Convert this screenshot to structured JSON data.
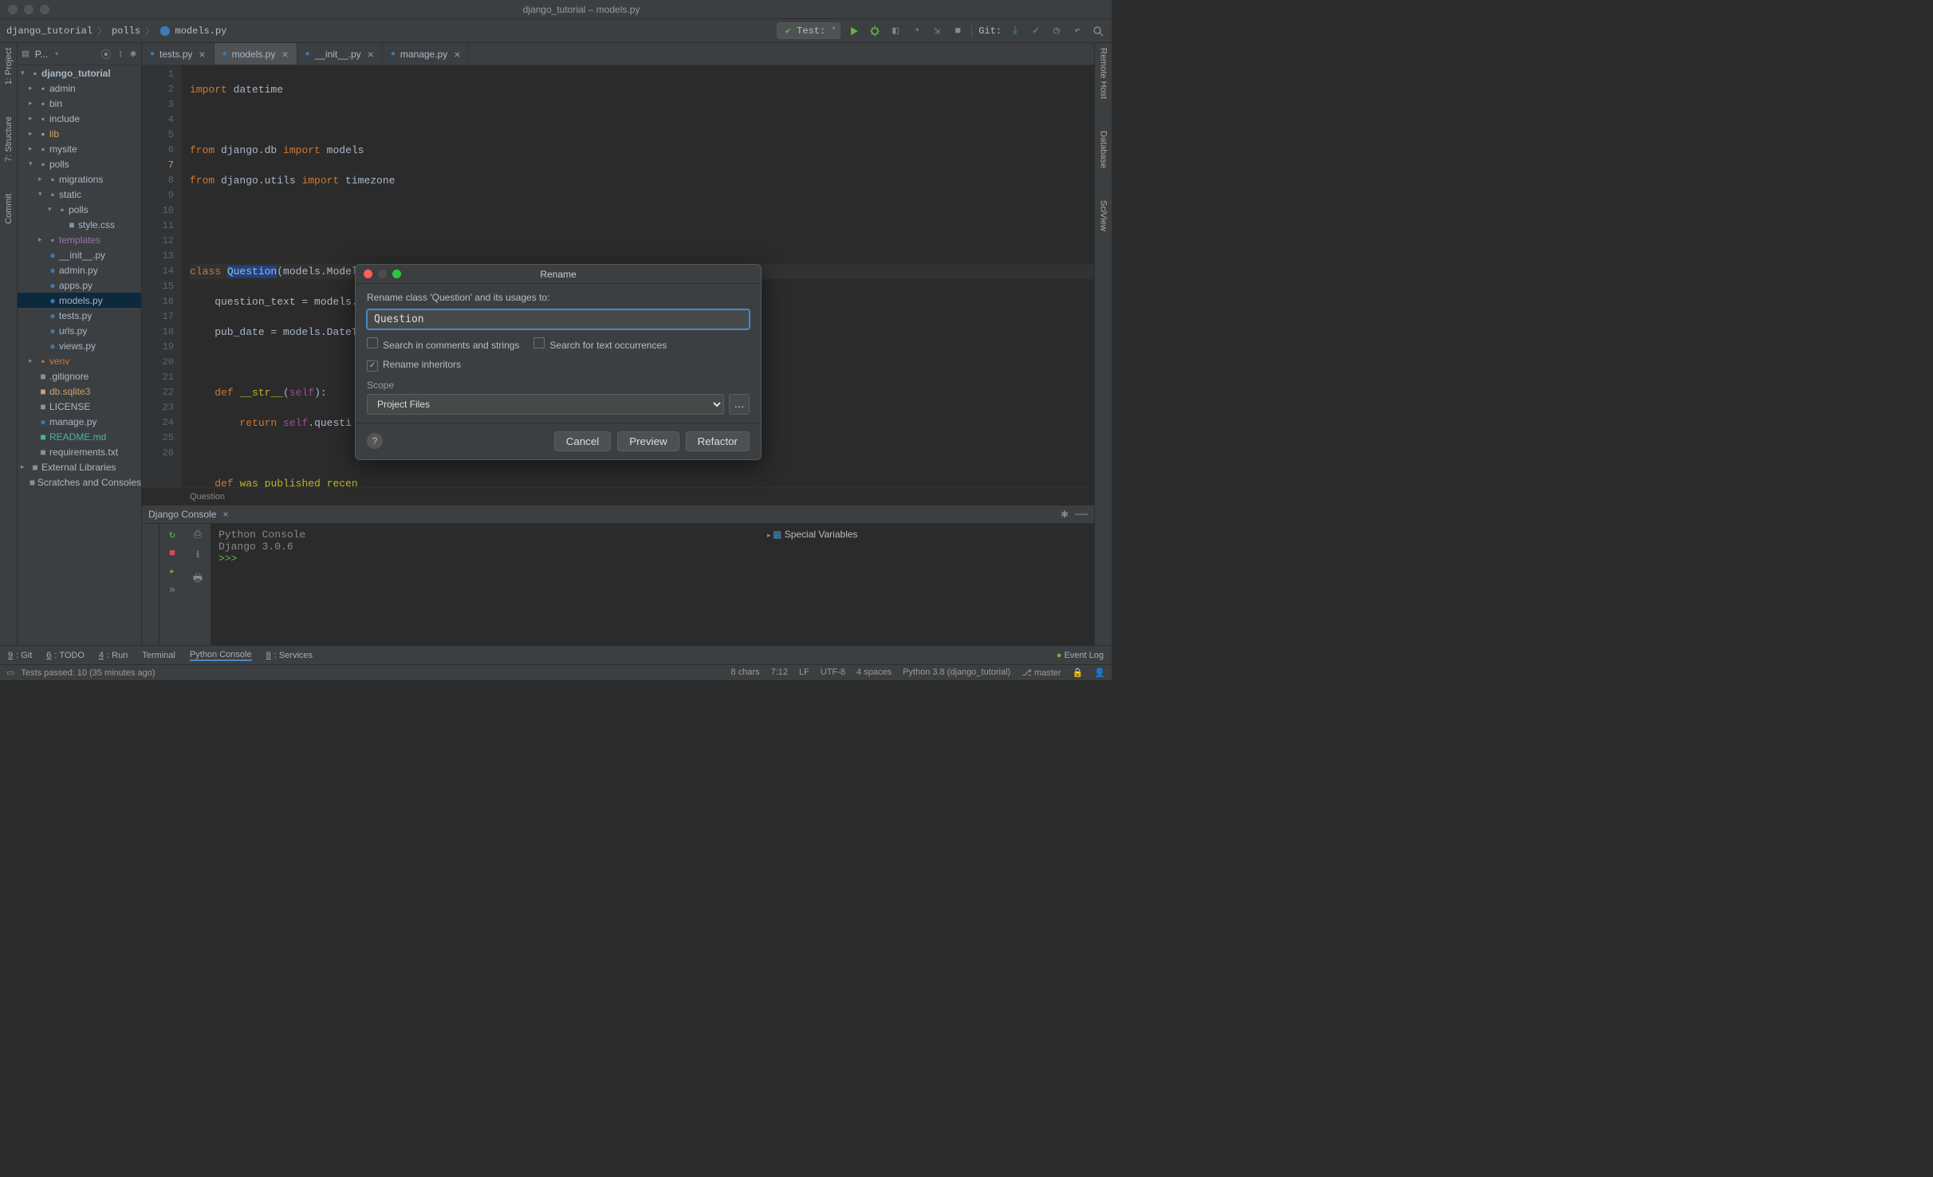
{
  "window": {
    "title": "django_tutorial – models.py"
  },
  "breadcrumb": [
    "django_tutorial",
    "polls",
    "models.py"
  ],
  "runConfig": "Test:",
  "gitLabel": "Git:",
  "leftGutter": [
    "1: Project",
    "7: Structure",
    "Commit"
  ],
  "rightGutter": [
    "Remote Host",
    "Database",
    "SciView"
  ],
  "projectPanel": {
    "title": "P...",
    "tree": [
      {
        "d": 0,
        "chev": "▾",
        "icon": "folder",
        "label": "django_tutorial",
        "bold": true
      },
      {
        "d": 1,
        "chev": "▸",
        "icon": "folder",
        "label": "admin"
      },
      {
        "d": 1,
        "chev": "▸",
        "icon": "folder",
        "label": "bin"
      },
      {
        "d": 1,
        "chev": "▸",
        "icon": "folder",
        "label": "include"
      },
      {
        "d": 1,
        "chev": "▸",
        "icon": "folder",
        "label": "lib",
        "color": "yellow"
      },
      {
        "d": 1,
        "chev": "▸",
        "icon": "folder",
        "label": "mysite"
      },
      {
        "d": 1,
        "chev": "▾",
        "icon": "folder",
        "label": "polls"
      },
      {
        "d": 2,
        "chev": "▸",
        "icon": "folder",
        "label": "migrations"
      },
      {
        "d": 2,
        "chev": "▾",
        "icon": "folder",
        "label": "static"
      },
      {
        "d": 3,
        "chev": "▾",
        "icon": "folder",
        "label": "polls"
      },
      {
        "d": 4,
        "chev": "",
        "icon": "css",
        "label": "style.css"
      },
      {
        "d": 2,
        "chev": "▸",
        "icon": "folder",
        "label": "templates",
        "color": "purple"
      },
      {
        "d": 2,
        "chev": "",
        "icon": "py",
        "label": "__init__.py"
      },
      {
        "d": 2,
        "chev": "",
        "icon": "py",
        "label": "admin.py"
      },
      {
        "d": 2,
        "chev": "",
        "icon": "py",
        "label": "apps.py"
      },
      {
        "d": 2,
        "chev": "",
        "icon": "py",
        "label": "models.py",
        "selected": true
      },
      {
        "d": 2,
        "chev": "",
        "icon": "py",
        "label": "tests.py"
      },
      {
        "d": 2,
        "chev": "",
        "icon": "py",
        "label": "urls.py"
      },
      {
        "d": 2,
        "chev": "",
        "icon": "py",
        "label": "views.py"
      },
      {
        "d": 1,
        "chev": "▸",
        "icon": "folder",
        "label": "venv",
        "color": "orange"
      },
      {
        "d": 1,
        "chev": "",
        "icon": "txt",
        "label": ".gitignore"
      },
      {
        "d": 1,
        "chev": "",
        "icon": "db",
        "label": "db.sqlite3",
        "color": "yellow"
      },
      {
        "d": 1,
        "chev": "",
        "icon": "txt",
        "label": "LICENSE"
      },
      {
        "d": 1,
        "chev": "",
        "icon": "py",
        "label": "manage.py"
      },
      {
        "d": 1,
        "chev": "",
        "icon": "md",
        "label": "README.md",
        "color": "teal"
      },
      {
        "d": 1,
        "chev": "",
        "icon": "txt",
        "label": "requirements.txt"
      },
      {
        "d": 0,
        "chev": "▸",
        "icon": "lib",
        "label": "External Libraries"
      },
      {
        "d": 0,
        "chev": "",
        "icon": "scratch",
        "label": "Scratches and Consoles"
      }
    ]
  },
  "tabs": [
    {
      "label": "tests.py",
      "active": false
    },
    {
      "label": "models.py",
      "active": true
    },
    {
      "label": "__init__.py",
      "active": false
    },
    {
      "label": "manage.py",
      "active": false
    }
  ],
  "lineNumbers": [
    1,
    2,
    3,
    4,
    5,
    6,
    7,
    8,
    9,
    10,
    11,
    12,
    13,
    14,
    15,
    16,
    17,
    18,
    19,
    20,
    21,
    22,
    23,
    24,
    25,
    26
  ],
  "currentLine": 7,
  "crumbBar": "Question",
  "dialog": {
    "title": "Rename",
    "label": "Rename class 'Question' and its usages to:",
    "value": "Question",
    "chkComments": "Search in comments and strings",
    "chkText": "Search for text occurrences",
    "chkInherit": "Rename inheritors",
    "scopeLabel": "Scope",
    "scopeValue": "Project Files",
    "btnCancel": "Cancel",
    "btnPreview": "Preview",
    "btnRefactor": "Refactor"
  },
  "console": {
    "tabTitle": "Django Console",
    "lines": [
      "Python Console",
      "Django 3.0.6",
      "",
      ">>>"
    ],
    "rightLabel": "Special Variables"
  },
  "toolWindows": [
    {
      "label": "9: Git",
      "u": "9"
    },
    {
      "label": "6: TODO",
      "u": "6"
    },
    {
      "label": "4: Run",
      "u": "4"
    },
    {
      "label": "Terminal"
    },
    {
      "label": "Python Console",
      "active": true
    },
    {
      "label": "8: Services",
      "u": "8"
    }
  ],
  "eventLog": "Event Log",
  "status": {
    "left": "Tests passed: 10 (35 minutes ago)",
    "right": [
      "8 chars",
      "7:12",
      "LF",
      "UTF-8",
      "4 spaces",
      "Python 3.8 (django_tutorial)",
      "⎇ master"
    ]
  }
}
